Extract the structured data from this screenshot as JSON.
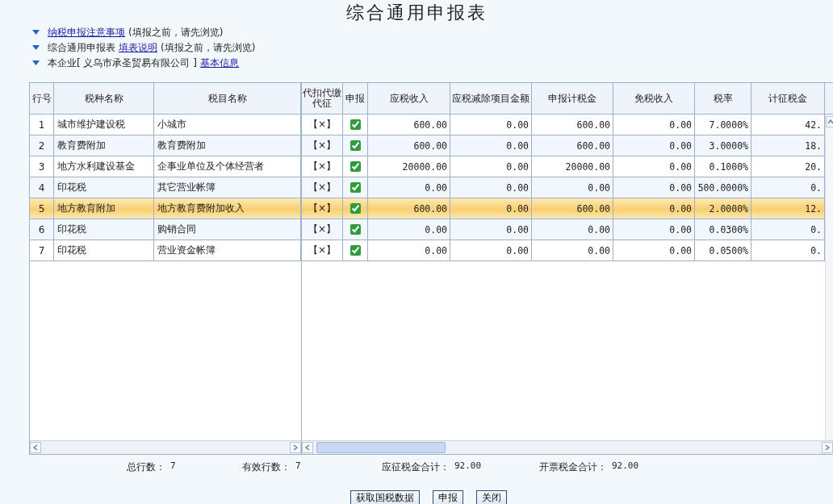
{
  "title": "综合通用申报表",
  "notices": [
    {
      "parts": [
        {
          "kind": "link",
          "text": "纳税申报注意事项"
        },
        {
          "kind": "text",
          "text": "(填报之前，请先浏览)"
        }
      ]
    },
    {
      "parts": [
        {
          "kind": "text",
          "text": "综合通用申报表"
        },
        {
          "kind": "link",
          "text": "填表说明"
        },
        {
          "kind": "text",
          "text": "(填报之前，请先浏览)"
        }
      ]
    },
    {
      "parts": [
        {
          "kind": "text",
          "text": "本企业[ 义乌市承圣贸易有限公司 ]"
        },
        {
          "kind": "link",
          "text": "基本信息"
        }
      ]
    }
  ],
  "table": {
    "columns": [
      "行号",
      "税种名称",
      "税目名称",
      "代扣代缴代征",
      "申报",
      "应税收入",
      "应税减除项目金额",
      "申报计税金",
      "免税收入",
      "税率",
      "计征税金"
    ],
    "rows": [
      {
        "no": "1",
        "tax_type": "城市维护建设税",
        "item": "小城市",
        "withhold": "【×】",
        "reported": true,
        "taxable": "600.00",
        "deduction": "0.00",
        "declared": "600.00",
        "exempt": "0.00",
        "rate": "7.0000%",
        "levied": "42.",
        "selected": false
      },
      {
        "no": "2",
        "tax_type": "教育费附加",
        "item": "教育费附加",
        "withhold": "【×】",
        "reported": true,
        "taxable": "600.00",
        "deduction": "0.00",
        "declared": "600.00",
        "exempt": "0.00",
        "rate": "3.0000%",
        "levied": "18.",
        "selected": false
      },
      {
        "no": "3",
        "tax_type": "地方水利建设基金",
        "item": "企事业单位及个体经营者",
        "withhold": "【×】",
        "reported": true,
        "taxable": "20000.00",
        "deduction": "0.00",
        "declared": "20000.00",
        "exempt": "0.00",
        "rate": "0.1000%",
        "levied": "20.",
        "selected": false
      },
      {
        "no": "4",
        "tax_type": "印花税",
        "item": "其它营业帐簿",
        "withhold": "【×】",
        "reported": true,
        "taxable": "0.00",
        "deduction": "0.00",
        "declared": "0.00",
        "exempt": "0.00",
        "rate": "500.0000%",
        "levied": "0.",
        "selected": false
      },
      {
        "no": "5",
        "tax_type": "地方教育附加",
        "item": "地方教育费附加收入",
        "withhold": "【×】",
        "reported": true,
        "taxable": "600.00",
        "deduction": "0.00",
        "declared": "600.00",
        "exempt": "0.00",
        "rate": "2.0000%",
        "levied": "12.",
        "selected": true
      },
      {
        "no": "6",
        "tax_type": "印花税",
        "item": "购销合同",
        "withhold": "【×】",
        "reported": true,
        "taxable": "0.00",
        "deduction": "0.00",
        "declared": "0.00",
        "exempt": "0.00",
        "rate": "0.0300%",
        "levied": "0.",
        "selected": false
      },
      {
        "no": "7",
        "tax_type": "印花税",
        "item": "营业资金帐簿",
        "withhold": "【×】",
        "reported": true,
        "taxable": "0.00",
        "deduction": "0.00",
        "declared": "0.00",
        "exempt": "0.00",
        "rate": "0.0500%",
        "levied": "0.",
        "selected": false
      }
    ]
  },
  "summary": [
    {
      "label": "总行数：",
      "value": "7"
    },
    {
      "label": "有效行数：",
      "value": "7"
    },
    {
      "label": "应征税金合计：",
      "value": "92.00"
    },
    {
      "label": "开票税金合计：",
      "value": "92.00"
    }
  ],
  "buttons": [
    "获取国税数据",
    "申报",
    "关闭"
  ]
}
